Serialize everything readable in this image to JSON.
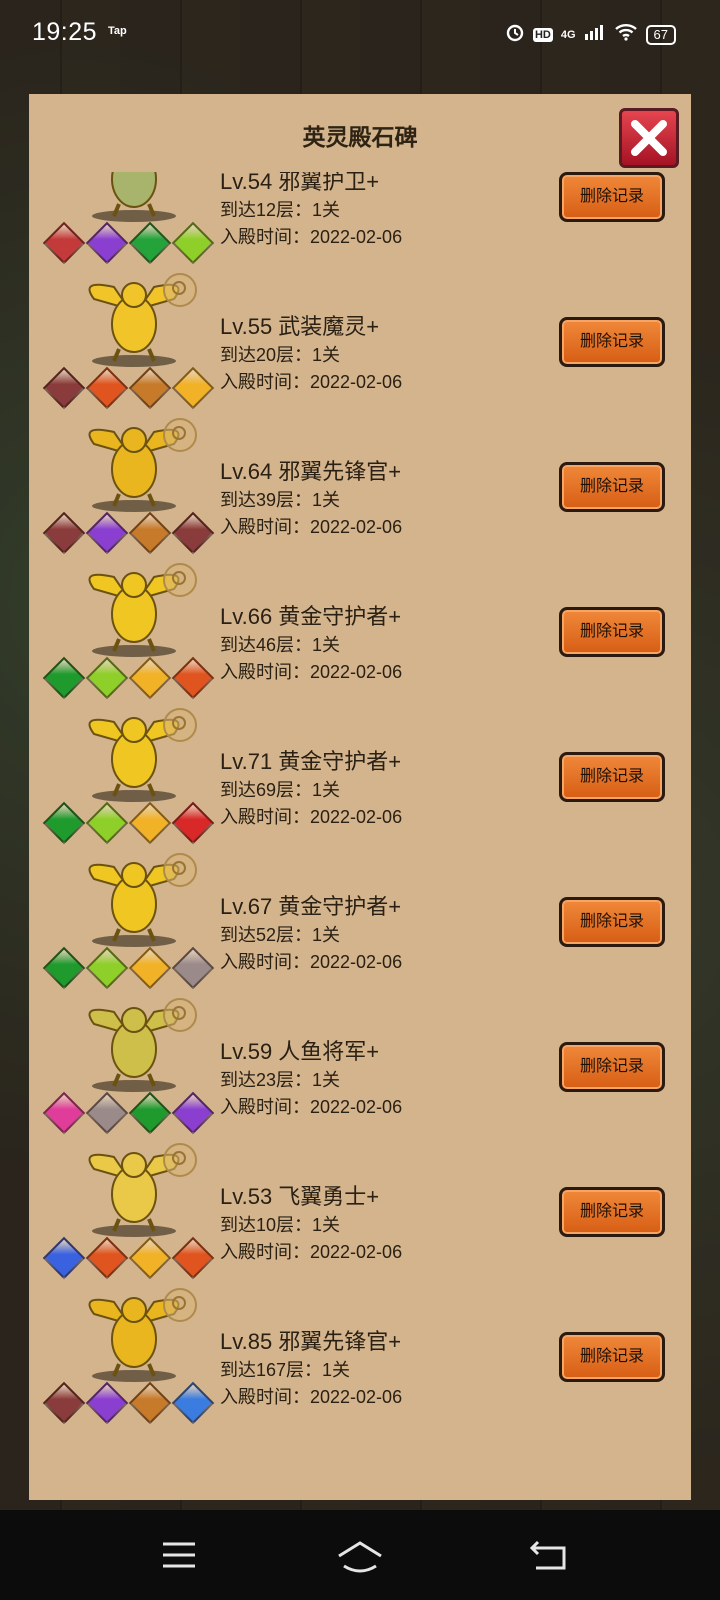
{
  "status_bar": {
    "time": "19:25",
    "tap_label": "Tap",
    "hd": "HD",
    "network": "4G",
    "battery": "67"
  },
  "panel": {
    "title": "英灵殿石碑",
    "delete_label": "删除记录"
  },
  "records": [
    {
      "name": "Lv.54 邪翼护卫+",
      "floor": "到达12层：1关",
      "date": "入殿时间：2022-02-06",
      "gems": [
        "#c43a3a",
        "#8b3fd1",
        "#23a33a",
        "#8fcf2a"
      ],
      "figure_color": "#a8b36c"
    },
    {
      "name": "Lv.55 武装魔灵+",
      "floor": "到达20层：1关",
      "date": "入殿时间：2022-02-06",
      "gems": [
        "#8a3b3b",
        "#e05420",
        "#c77a2a",
        "#f2b227"
      ],
      "figure_color": "#f1c52a"
    },
    {
      "name": "Lv.64 邪翼先锋官+",
      "floor": "到达39层：1关",
      "date": "入殿时间：2022-02-06",
      "gems": [
        "#8a3b3b",
        "#8b3fd1",
        "#c77a2a",
        "#8a3b3b"
      ],
      "figure_color": "#e9b620"
    },
    {
      "name": "Lv.66 黄金守护者+",
      "floor": "到达46层：1关",
      "date": "入殿时间：2022-02-06",
      "gems": [
        "#1f9b2e",
        "#8fcf2a",
        "#f2b227",
        "#e05420"
      ],
      "figure_color": "#f0c623"
    },
    {
      "name": "Lv.71 黄金守护者+",
      "floor": "到达69层：1关",
      "date": "入殿时间：2022-02-06",
      "gems": [
        "#1f9b2e",
        "#8fcf2a",
        "#f2b227",
        "#d82828"
      ],
      "figure_color": "#f0c623"
    },
    {
      "name": "Lv.67 黄金守护者+",
      "floor": "到达52层：1关",
      "date": "入殿时间：2022-02-06",
      "gems": [
        "#1f9b2e",
        "#8fcf2a",
        "#f2b227",
        "#9a8a8a"
      ],
      "figure_color": "#f0c623"
    },
    {
      "name": "Lv.59 人鱼将军+",
      "floor": "到达23层：1关",
      "date": "入殿时间：2022-02-06",
      "gems": [
        "#e03c9a",
        "#9a8a8a",
        "#1f9b2e",
        "#8b3fd1"
      ],
      "figure_color": "#cdbf4a"
    },
    {
      "name": "Lv.53 飞翼勇士+",
      "floor": "到达10层：1关",
      "date": "入殿时间：2022-02-06",
      "gems": [
        "#3a62e0",
        "#e05420",
        "#f2b227",
        "#e05420"
      ],
      "figure_color": "#e9c947"
    },
    {
      "name": "Lv.85 邪翼先锋官+",
      "floor": "到达167层：1关",
      "date": "入殿时间：2022-02-06",
      "gems": [
        "#8a3b3b",
        "#8b3fd1",
        "#c77a2a",
        "#3a7ce0"
      ],
      "figure_color": "#e9b620"
    }
  ]
}
